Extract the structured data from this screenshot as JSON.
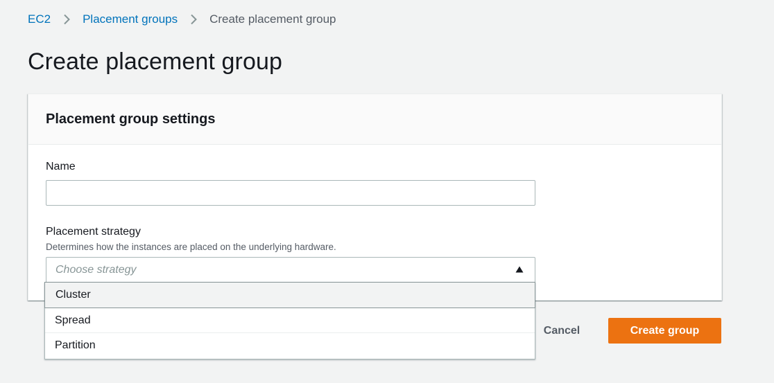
{
  "breadcrumb": {
    "items": [
      {
        "label": "EC2"
      },
      {
        "label": "Placement groups"
      },
      {
        "label": "Create placement group"
      }
    ]
  },
  "page": {
    "title": "Create placement group"
  },
  "settings": {
    "header": "Placement group settings",
    "name": {
      "label": "Name",
      "value": ""
    },
    "strategy": {
      "label": "Placement strategy",
      "description": "Determines how the instances are placed on the underlying hardware.",
      "placeholder": "Choose strategy",
      "options": [
        "Cluster",
        "Spread",
        "Partition"
      ],
      "highlighted_option": "Cluster",
      "expanded": true
    }
  },
  "actions": {
    "cancel_label": "Cancel",
    "create_label": "Create group"
  },
  "icons": {
    "breadcrumb_separator": "chevron-right-icon",
    "select_caret": "caret-up-icon"
  },
  "colors": {
    "link": "#0073bb",
    "primary_button": "#ec7211",
    "background": "#f2f3f3",
    "text": "#16191f",
    "secondary_text": "#545b64",
    "placeholder": "#879596"
  }
}
